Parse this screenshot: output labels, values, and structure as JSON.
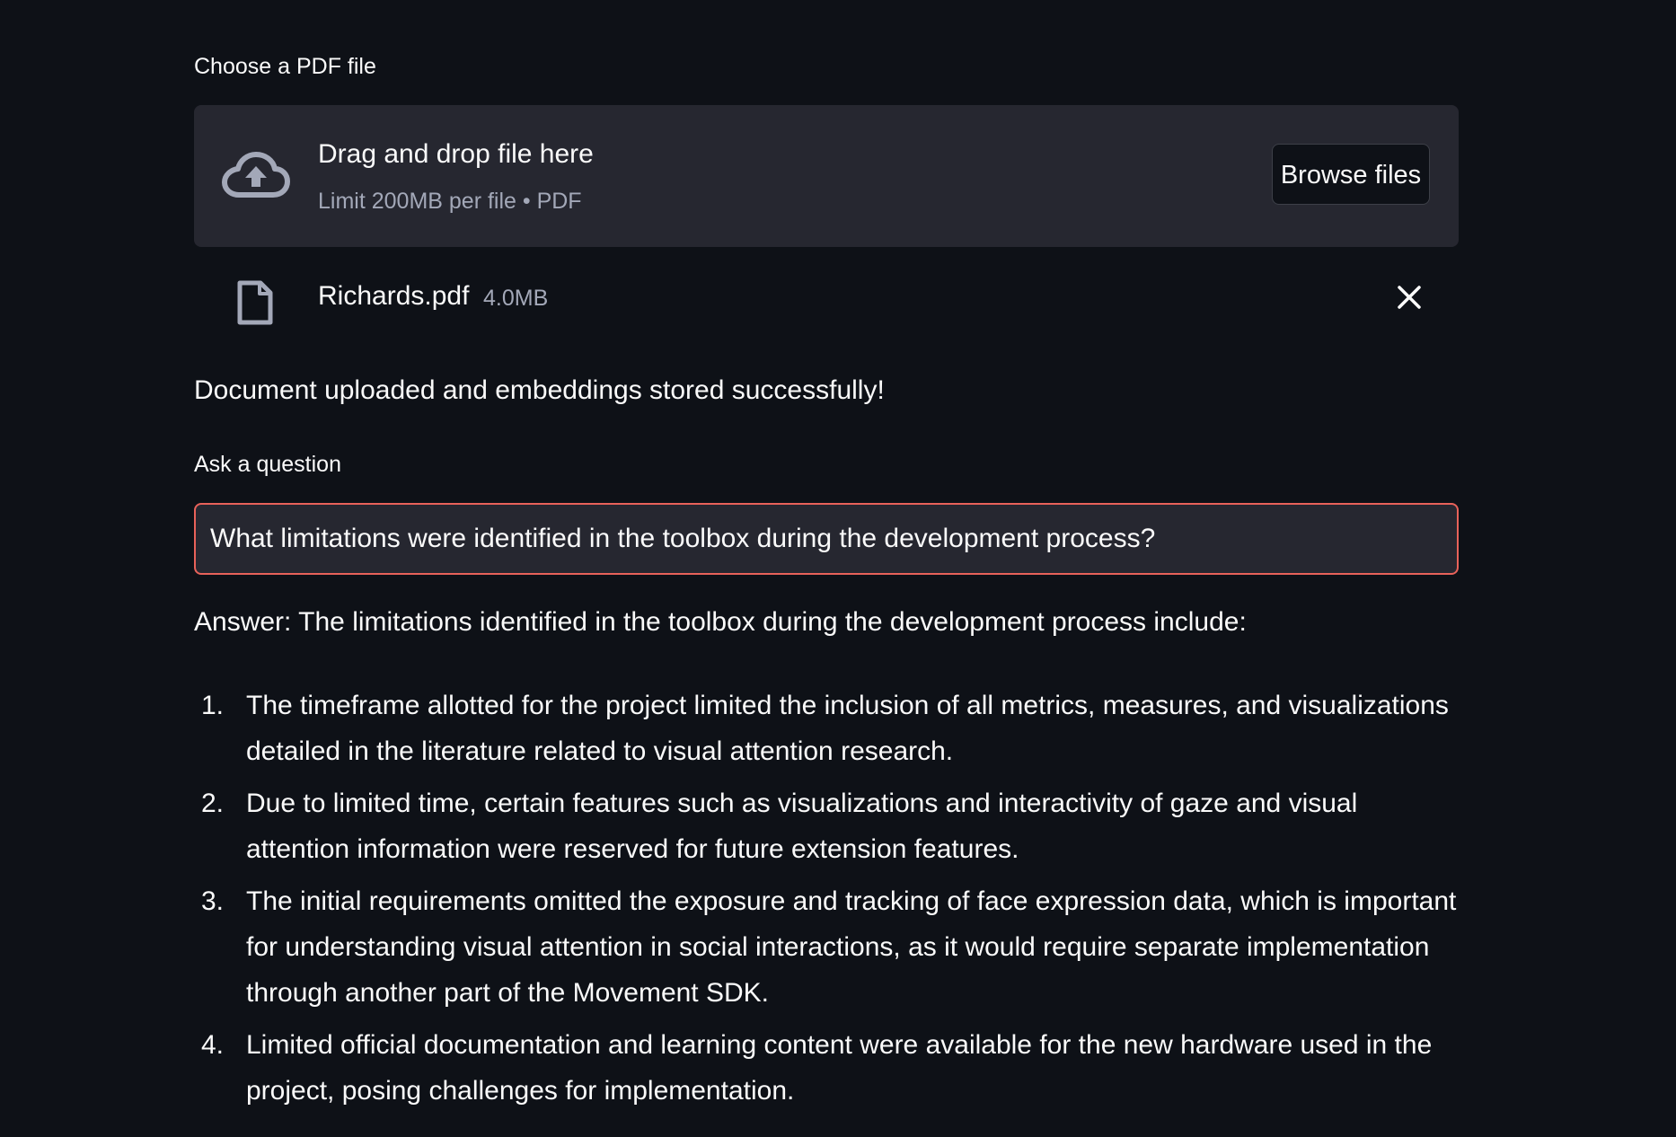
{
  "uploader": {
    "label": "Choose a PDF file",
    "drop_title": "Drag and drop file here",
    "drop_limit": "Limit 200MB per file • PDF",
    "browse_label": "Browse files",
    "cloud_icon": "cloud-upload-icon"
  },
  "uploaded_file": {
    "name": "Richards.pdf",
    "size": "4.0MB",
    "file_icon": "file-icon",
    "remove_icon": "close-icon"
  },
  "status": {
    "success_message": "Document uploaded and embeddings stored successfully!"
  },
  "question": {
    "label": "Ask a question",
    "value": "What limitations were identified in the toolbox during the development process?"
  },
  "answer": {
    "intro": "Answer: The limitations identified in the toolbox during the development process include:",
    "items": [
      {
        "number": "1.",
        "text": "The timeframe allotted for the project limited the inclusion of all metrics, measures, and visualizations detailed in the literature related to visual attention research."
      },
      {
        "number": "2.",
        "text": "Due to limited time, certain features such as visualizations and interactivity of gaze and visual attention information were reserved for future extension features."
      },
      {
        "number": "3.",
        "text": "The initial requirements omitted the exposure and tracking of face expression data, which is important for understanding visual attention in social interactions, as it would require separate implementation through another part of the Movement SDK."
      },
      {
        "number": "4.",
        "text": "Limited official documentation and learning content were available for the new hardware used in the project, posing challenges for implementation."
      }
    ]
  },
  "colors": {
    "background": "#0e1117",
    "panel": "#262730",
    "input_border_focus": "#e8625a",
    "muted_text": "#a3a8b8",
    "text": "#fafafa"
  }
}
